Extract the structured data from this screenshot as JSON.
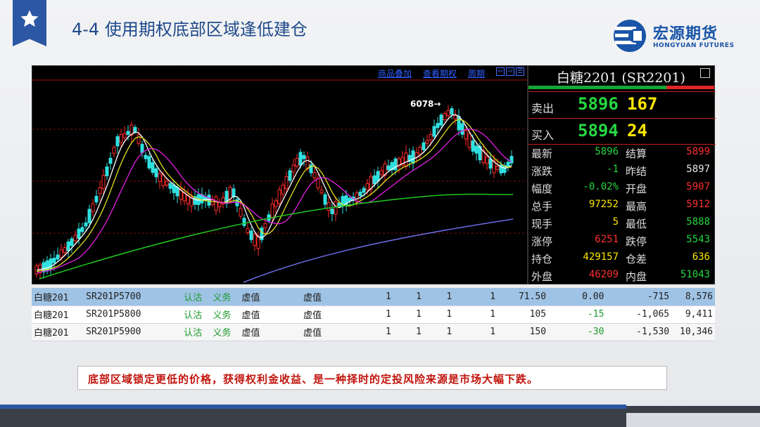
{
  "header": {
    "title": "4-4  使用期权底部区域逢低建仓",
    "logo_name": "宏源期货",
    "logo_en": "HONGYUAN FUTURES"
  },
  "chart": {
    "toolbar": [
      "商品叠加",
      "查看期权",
      "周期"
    ],
    "toolbar_icons": [
      "⇦",
      "⇨",
      "☰"
    ],
    "peak_label": "6078→"
  },
  "chart_data": {
    "type": "candlestick",
    "annotations": [
      "6078→"
    ],
    "peak": 6078
  },
  "quote": {
    "title": "白糖2201 (SR2201)",
    "sell_label": "卖出",
    "sell_price": "5896",
    "sell_qty": "167",
    "buy_label": "买入",
    "buy_price": "5894",
    "buy_qty": "24",
    "rows": [
      {
        "l1": "最新",
        "v1": "5896",
        "c1": "#27d742",
        "l2": "结算",
        "v2": "5899",
        "c2": "#ff3030"
      },
      {
        "l1": "涨跌",
        "v1": "-1",
        "c1": "#27d742",
        "l2": "昨结",
        "v2": "5897",
        "c2": "#e8e8e8"
      },
      {
        "l1": "幅度",
        "v1": "-0.02%",
        "c1": "#27d742",
        "l2": "开盘",
        "v2": "5907",
        "c2": "#ff3030"
      },
      {
        "l1": "总手",
        "v1": "97252",
        "c1": "#ffe600",
        "l2": "最高",
        "v2": "5912",
        "c2": "#ff3030"
      },
      {
        "l1": "现手",
        "v1": "5",
        "c1": "#ffe600",
        "l2": "最低",
        "v2": "5888",
        "c2": "#27d742"
      },
      {
        "l1": "涨停",
        "v1": "6251",
        "c1": "#ff3030",
        "l2": "跌停",
        "v2": "5543",
        "c2": "#27d742"
      },
      {
        "l1": "持仓",
        "v1": "429157",
        "c1": "#ffe600",
        "l2": "仓差",
        "v2": "636",
        "c2": "#ffe600"
      },
      {
        "l1": "外盘",
        "v1": "46209",
        "c1": "#ff3030",
        "l2": "内盘",
        "v2": "51043",
        "c2": "#27d742"
      }
    ]
  },
  "options": [
    {
      "name": "白糖201",
      "code": "SR201P5700",
      "a": "认沽",
      "b": "义务",
      "c": "虚值",
      "d": "虚值",
      "n1": "1",
      "n2": "1",
      "n3": "1",
      "n4": "1",
      "p": "71.50",
      "chg": "0.00",
      "x": "-715",
      "y": "8,576"
    },
    {
      "name": "白糖201",
      "code": "SR201P5800",
      "a": "认沽",
      "b": "义务",
      "c": "虚值",
      "d": "虚值",
      "n1": "1",
      "n2": "1",
      "n3": "1",
      "n4": "1",
      "p": "105",
      "chg": "-15",
      "x": "-1,065",
      "y": "9,411"
    },
    {
      "name": "白糖201",
      "code": "SR201P5900",
      "a": "认沽",
      "b": "义务",
      "c": "虚值",
      "d": "虚值",
      "n1": "1",
      "n2": "1",
      "n3": "1",
      "n4": "1",
      "p": "150",
      "chg": "-30",
      "x": "-1,530",
      "y": "10,346"
    }
  ],
  "caption": "底部区域锁定更低的价格，获得权利金收益、是一种择时的定投风险来源是市场大幅下跌。"
}
